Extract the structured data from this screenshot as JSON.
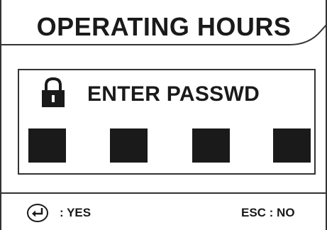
{
  "header": {
    "title": "OPERATING HOURS"
  },
  "dialog": {
    "icon": "lock-icon",
    "prompt": "ENTER PASSWD",
    "password_slots": [
      {
        "filled": true
      },
      {
        "filled": true
      },
      {
        "filled": true
      },
      {
        "filled": true
      }
    ]
  },
  "footer": {
    "enter_icon": "enter-return-icon",
    "yes_label": ": YES",
    "esc_label": "ESC : NO"
  },
  "colors": {
    "background": "#ffffff",
    "foreground": "#1a1a1a",
    "frame": "#333333"
  }
}
